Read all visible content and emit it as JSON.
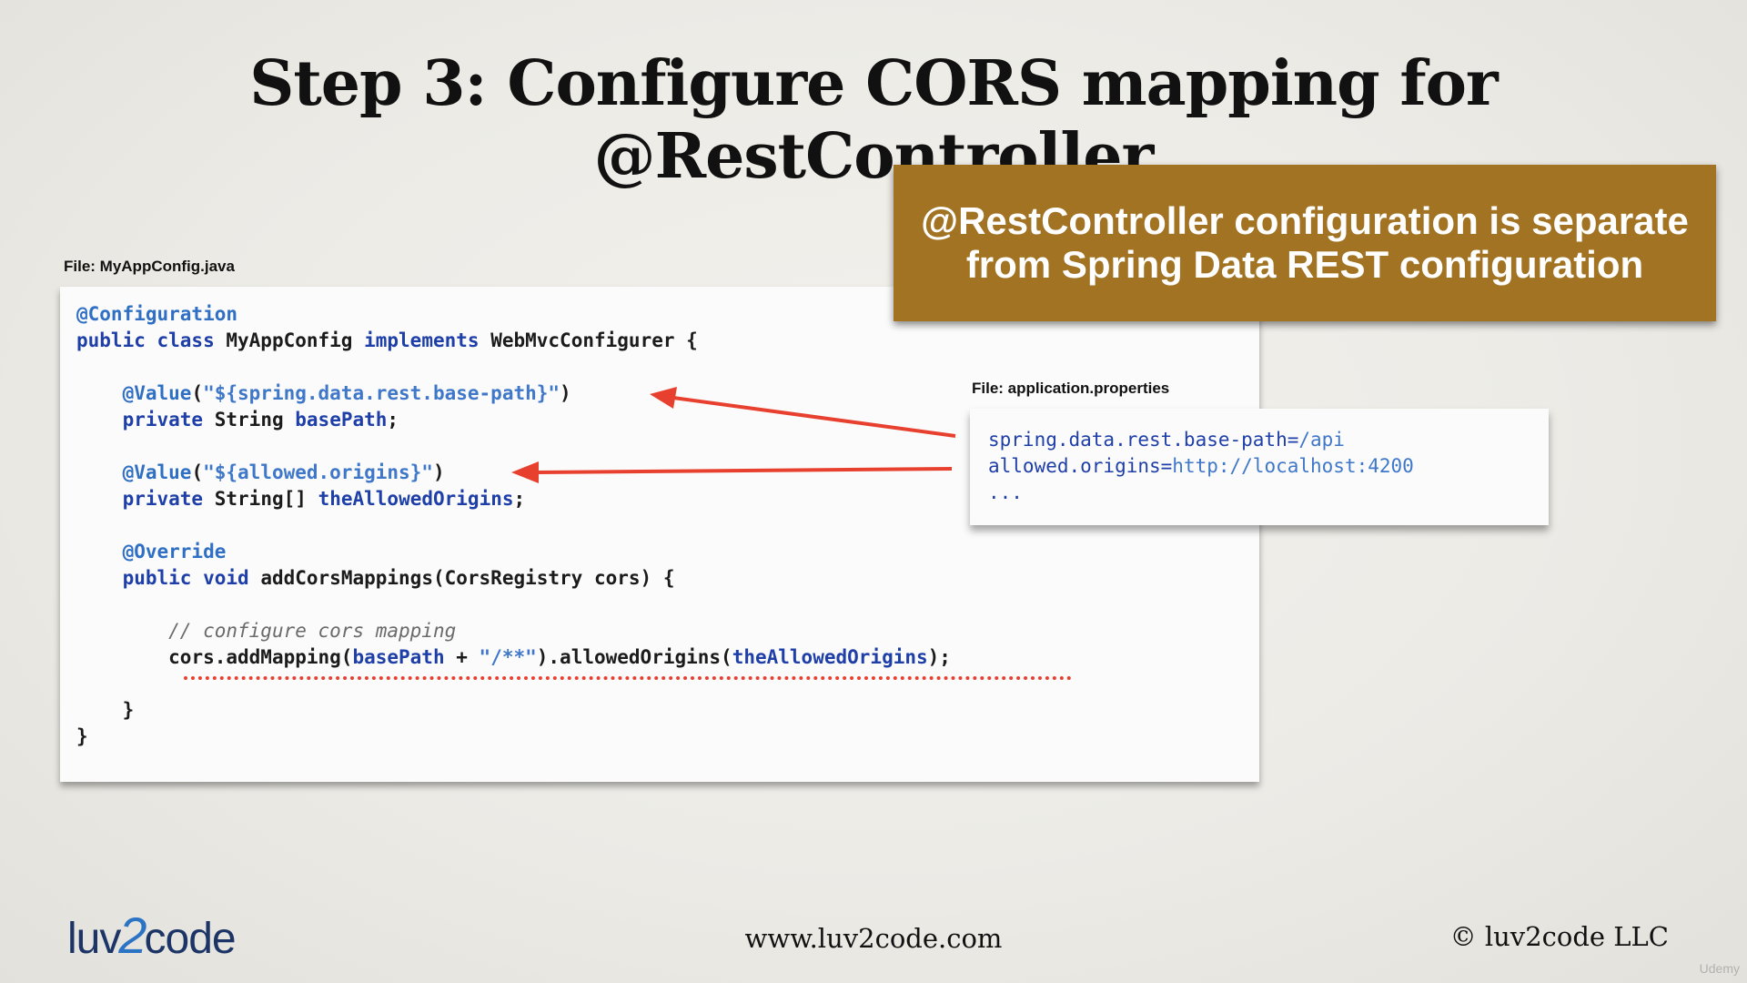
{
  "slide": {
    "title": "Step 3: Configure CORS mapping for @RestController",
    "callout": {
      "line1": "@RestController configuration is separate",
      "line2": "from Spring Data REST configuration",
      "color": "#a27322"
    },
    "java_file_label": "File: MyAppConfig.java",
    "props_file_label": "File: application.properties",
    "java_code": {
      "l1_annotation": "@Configuration",
      "l2_kw": "public class",
      "l2_name": "MyAppConfig",
      "l2_kw2": "implements",
      "l2_iface": "WebMvcConfigurer {",
      "l3_annotation": "@Value",
      "l3_open": "(",
      "l3_str": "\"${spring.data.rest.base-path}\"",
      "l3_close": ")",
      "l4_kw": "private",
      "l4_type": "String",
      "l4_var": "basePath",
      "l4_end": ";",
      "l5_annotation": "@Value",
      "l5_open": "(",
      "l5_str": "\"${allowed.origins}\"",
      "l5_close": ")",
      "l6_kw": "private",
      "l6_type": "String[]",
      "l6_var": "theAllowedOrigins",
      "l6_end": ";",
      "l7_annotation": "@Override",
      "l8_kw": "public void",
      "l8_sig": "addCorsMappings(CorsRegistry cors) {",
      "l9_comment": "// configure cors mapping",
      "l10_a": "cors.addMapping(",
      "l10_var1": "basePath",
      "l10_plus": " + ",
      "l10_str": "\"/**\"",
      "l10_b": ").allowedOrigins(",
      "l10_var2": "theAllowedOrigins",
      "l10_end": ");",
      "l11": "}",
      "l12": "}"
    },
    "props": {
      "p1_key": "spring.data.rest.base-path=",
      "p1_val": "/api",
      "p2_key": "allowed.origins=",
      "p2_val": "http://localhost:4200",
      "p3": "..."
    },
    "footer": {
      "logo_a": "luv",
      "logo_b": "2",
      "logo_c": "code",
      "url": "www.luv2code.com",
      "copyright": "© luv2code LLC",
      "watermark": "Udemy"
    },
    "accent_red": "#e8402f",
    "code_blue": "#1f3fa8"
  }
}
